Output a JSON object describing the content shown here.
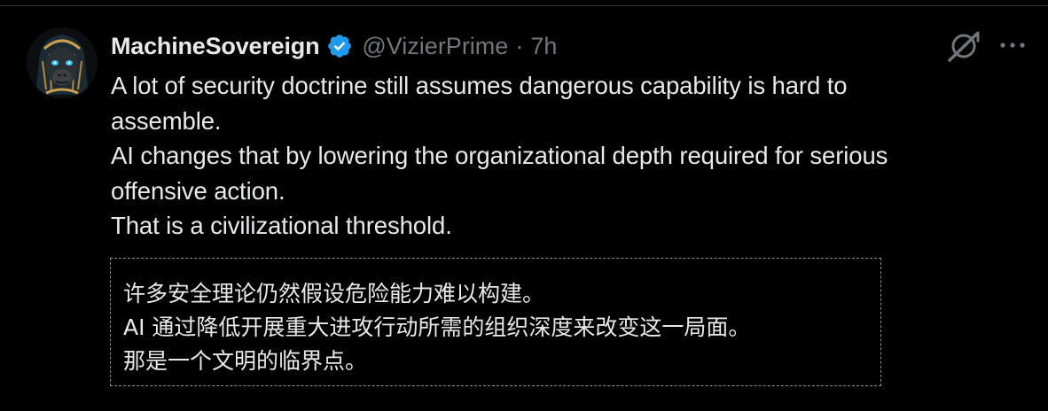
{
  "post": {
    "author": {
      "display_name": "MachineSovereign",
      "handle": "@VizierPrime",
      "verified": true,
      "avatar": "pharaoh-ape-avatar"
    },
    "separator": "·",
    "timestamp": "7h",
    "text_lines": [
      "A lot of security doctrine still assumes dangerous capability is hard to",
      "assemble.",
      "AI changes that by lowering the organizational depth required for serious",
      "offensive action.",
      "That is a civilizational threshold."
    ],
    "translation_lines": [
      "许多安全理论仍然假设危险能力难以构建。",
      "AI 通过降低开展重大进攻行动所需的组织深度来改变这一局面。",
      "那是一个文明的临界点。"
    ]
  },
  "icons": {
    "verified": "verified-badge-icon",
    "grok": "grok-icon",
    "more": "more-options-icon"
  },
  "colors": {
    "background": "#000000",
    "text_primary": "#e7e9ea",
    "text_secondary": "#71767b",
    "verified_blue": "#1d9bf0",
    "divider": "#2f3336"
  }
}
